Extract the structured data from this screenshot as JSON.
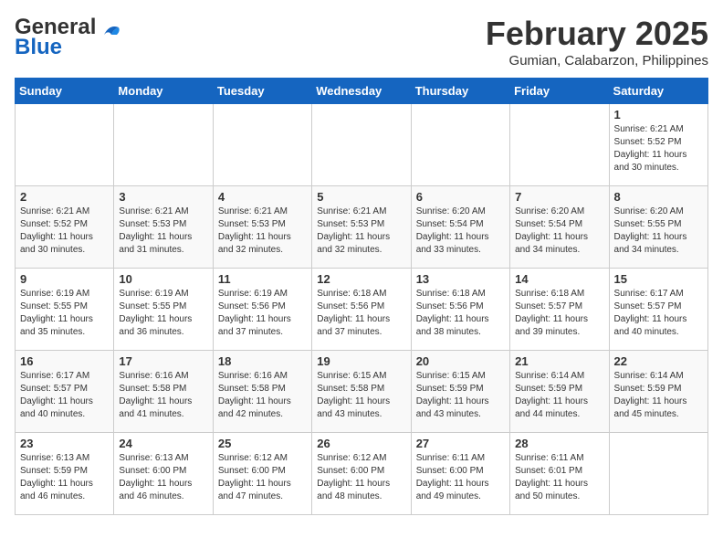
{
  "header": {
    "logo_line1": "General",
    "logo_line2": "Blue",
    "month": "February 2025",
    "location": "Gumian, Calabarzon, Philippines"
  },
  "days_of_week": [
    "Sunday",
    "Monday",
    "Tuesday",
    "Wednesday",
    "Thursday",
    "Friday",
    "Saturday"
  ],
  "weeks": [
    [
      {
        "day": "",
        "info": ""
      },
      {
        "day": "",
        "info": ""
      },
      {
        "day": "",
        "info": ""
      },
      {
        "day": "",
        "info": ""
      },
      {
        "day": "",
        "info": ""
      },
      {
        "day": "",
        "info": ""
      },
      {
        "day": "1",
        "info": "Sunrise: 6:21 AM\nSunset: 5:52 PM\nDaylight: 11 hours\nand 30 minutes."
      }
    ],
    [
      {
        "day": "2",
        "info": "Sunrise: 6:21 AM\nSunset: 5:52 PM\nDaylight: 11 hours\nand 30 minutes."
      },
      {
        "day": "3",
        "info": "Sunrise: 6:21 AM\nSunset: 5:53 PM\nDaylight: 11 hours\nand 31 minutes."
      },
      {
        "day": "4",
        "info": "Sunrise: 6:21 AM\nSunset: 5:53 PM\nDaylight: 11 hours\nand 32 minutes."
      },
      {
        "day": "5",
        "info": "Sunrise: 6:21 AM\nSunset: 5:53 PM\nDaylight: 11 hours\nand 32 minutes."
      },
      {
        "day": "6",
        "info": "Sunrise: 6:20 AM\nSunset: 5:54 PM\nDaylight: 11 hours\nand 33 minutes."
      },
      {
        "day": "7",
        "info": "Sunrise: 6:20 AM\nSunset: 5:54 PM\nDaylight: 11 hours\nand 34 minutes."
      },
      {
        "day": "8",
        "info": "Sunrise: 6:20 AM\nSunset: 5:55 PM\nDaylight: 11 hours\nand 34 minutes."
      }
    ],
    [
      {
        "day": "9",
        "info": "Sunrise: 6:19 AM\nSunset: 5:55 PM\nDaylight: 11 hours\nand 35 minutes."
      },
      {
        "day": "10",
        "info": "Sunrise: 6:19 AM\nSunset: 5:55 PM\nDaylight: 11 hours\nand 36 minutes."
      },
      {
        "day": "11",
        "info": "Sunrise: 6:19 AM\nSunset: 5:56 PM\nDaylight: 11 hours\nand 37 minutes."
      },
      {
        "day": "12",
        "info": "Sunrise: 6:18 AM\nSunset: 5:56 PM\nDaylight: 11 hours\nand 37 minutes."
      },
      {
        "day": "13",
        "info": "Sunrise: 6:18 AM\nSunset: 5:56 PM\nDaylight: 11 hours\nand 38 minutes."
      },
      {
        "day": "14",
        "info": "Sunrise: 6:18 AM\nSunset: 5:57 PM\nDaylight: 11 hours\nand 39 minutes."
      },
      {
        "day": "15",
        "info": "Sunrise: 6:17 AM\nSunset: 5:57 PM\nDaylight: 11 hours\nand 40 minutes."
      }
    ],
    [
      {
        "day": "16",
        "info": "Sunrise: 6:17 AM\nSunset: 5:57 PM\nDaylight: 11 hours\nand 40 minutes."
      },
      {
        "day": "17",
        "info": "Sunrise: 6:16 AM\nSunset: 5:58 PM\nDaylight: 11 hours\nand 41 minutes."
      },
      {
        "day": "18",
        "info": "Sunrise: 6:16 AM\nSunset: 5:58 PM\nDaylight: 11 hours\nand 42 minutes."
      },
      {
        "day": "19",
        "info": "Sunrise: 6:15 AM\nSunset: 5:58 PM\nDaylight: 11 hours\nand 43 minutes."
      },
      {
        "day": "20",
        "info": "Sunrise: 6:15 AM\nSunset: 5:59 PM\nDaylight: 11 hours\nand 43 minutes."
      },
      {
        "day": "21",
        "info": "Sunrise: 6:14 AM\nSunset: 5:59 PM\nDaylight: 11 hours\nand 44 minutes."
      },
      {
        "day": "22",
        "info": "Sunrise: 6:14 AM\nSunset: 5:59 PM\nDaylight: 11 hours\nand 45 minutes."
      }
    ],
    [
      {
        "day": "23",
        "info": "Sunrise: 6:13 AM\nSunset: 5:59 PM\nDaylight: 11 hours\nand 46 minutes."
      },
      {
        "day": "24",
        "info": "Sunrise: 6:13 AM\nSunset: 6:00 PM\nDaylight: 11 hours\nand 46 minutes."
      },
      {
        "day": "25",
        "info": "Sunrise: 6:12 AM\nSunset: 6:00 PM\nDaylight: 11 hours\nand 47 minutes."
      },
      {
        "day": "26",
        "info": "Sunrise: 6:12 AM\nSunset: 6:00 PM\nDaylight: 11 hours\nand 48 minutes."
      },
      {
        "day": "27",
        "info": "Sunrise: 6:11 AM\nSunset: 6:00 PM\nDaylight: 11 hours\nand 49 minutes."
      },
      {
        "day": "28",
        "info": "Sunrise: 6:11 AM\nSunset: 6:01 PM\nDaylight: 11 hours\nand 50 minutes."
      },
      {
        "day": "",
        "info": ""
      }
    ]
  ]
}
